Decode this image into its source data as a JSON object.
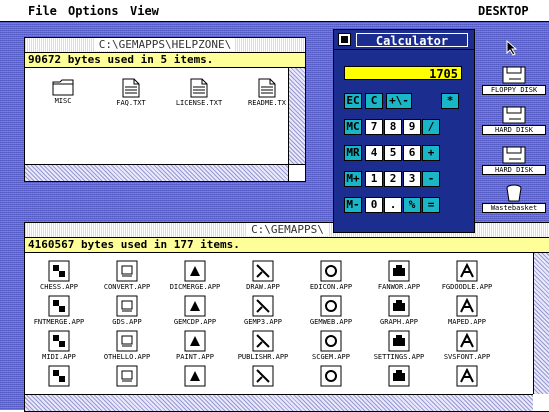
{
  "menu": {
    "file": "File",
    "options": "Options",
    "view": "View",
    "desktop": "DESKTOP"
  },
  "win1": {
    "title": "C:\\GEMAPPS\\HELPZONE\\",
    "info": "90672 bytes used in 5 items.",
    "items": [
      {
        "label": "MISC",
        "icon": "folder-icon"
      },
      {
        "label": "FAQ.TXT",
        "icon": "document-icon"
      },
      {
        "label": "LICENSE.TXT",
        "icon": "document-icon"
      },
      {
        "label": "README.TX",
        "icon": "document-icon"
      }
    ]
  },
  "win2": {
    "title": "C:\\GEMAPPS\\",
    "info": "4160567 bytes used in 177 items.",
    "items": [
      {
        "label": "CHESS.APP"
      },
      {
        "label": "CONVERT.APP"
      },
      {
        "label": "DICMERGE.APP"
      },
      {
        "label": "DRAW.APP"
      },
      {
        "label": "EDICON.APP"
      },
      {
        "label": "FANWOR.APP"
      },
      {
        "label": "FGDOODLE.APP"
      },
      {
        "label": "FNTMERGE.APP"
      },
      {
        "label": "GDS.APP"
      },
      {
        "label": "GEMCDP.APP"
      },
      {
        "label": "GEMP3.APP"
      },
      {
        "label": "GEMWEB.APP"
      },
      {
        "label": "GRAPH.APP"
      },
      {
        "label": "MAPED.APP"
      },
      {
        "label": "MIDI.APP"
      },
      {
        "label": "OTHELLO.APP"
      },
      {
        "label": "PAINT.APP"
      },
      {
        "label": "PUBLISHR.APP"
      },
      {
        "label": "SCGEM.APP"
      },
      {
        "label": "SETTINGS.APP"
      },
      {
        "label": "SVSFONT.APP"
      },
      {
        "label": ""
      },
      {
        "label": ""
      },
      {
        "label": ""
      },
      {
        "label": ""
      },
      {
        "label": ""
      },
      {
        "label": ""
      },
      {
        "label": ""
      }
    ]
  },
  "calculator": {
    "title": "Calculator",
    "display": "1705",
    "rows": [
      [
        "EC",
        "C",
        "+\\-",
        "*"
      ],
      [
        "MC",
        "7",
        "8",
        "9",
        "/"
      ],
      [
        "MR",
        "4",
        "5",
        "6",
        "+"
      ],
      [
        "M+",
        "1",
        "2",
        "3",
        "-"
      ],
      [
        "M-",
        "0",
        ".",
        "%",
        "="
      ]
    ]
  },
  "desktop_icons": [
    {
      "label": "FLOPPY DISK",
      "badge": "A",
      "icon": "floppy-disk-icon"
    },
    {
      "label": "HARD DISK",
      "badge": "C",
      "icon": "hard-disk-icon"
    },
    {
      "label": "HARD DISK",
      "badge": "D",
      "icon": "hard-disk-icon"
    },
    {
      "label": "Wastebasket",
      "badge": "",
      "icon": "wastebasket-icon"
    }
  ]
}
